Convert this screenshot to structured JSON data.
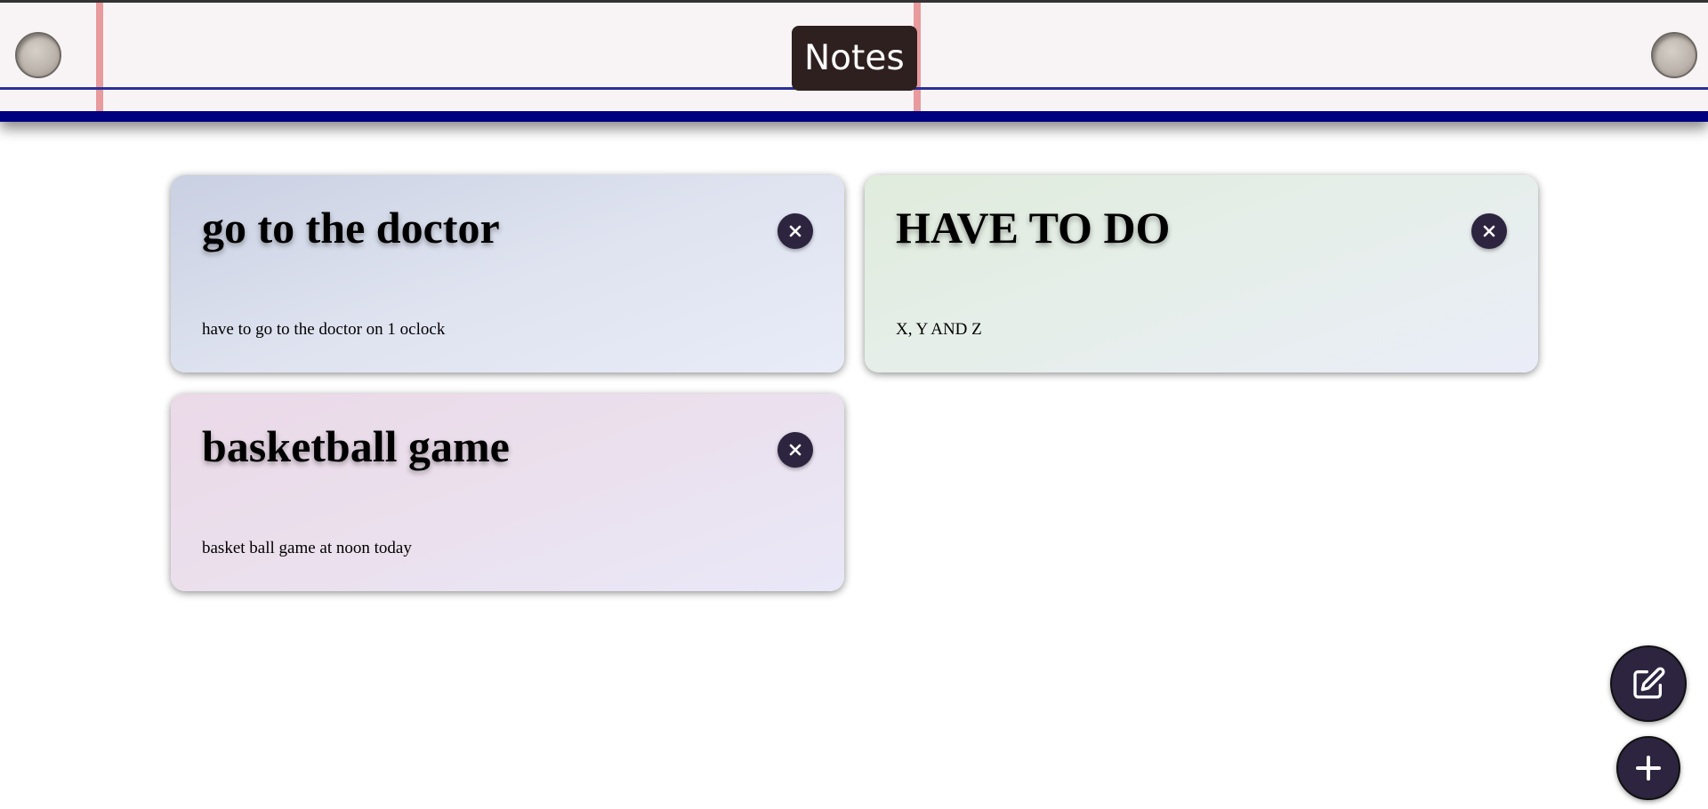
{
  "header": {
    "title": "Notes"
  },
  "notes": [
    {
      "title": "go to the doctor",
      "body": "have to go to the doctor on 1 oclock"
    },
    {
      "title": "HAVE TO DO",
      "body": "X, Y AND Z"
    },
    {
      "title": "basketball game",
      "body": "basket ball game at noon today"
    }
  ],
  "colors": {
    "accent": "#2d2440",
    "header_rule": "#010080",
    "margin_line": "#e89a9c",
    "title_badge": "#2f2020"
  },
  "icons": {
    "note_close": "close-icon",
    "edit": "edit-icon",
    "add": "plus-icon"
  }
}
